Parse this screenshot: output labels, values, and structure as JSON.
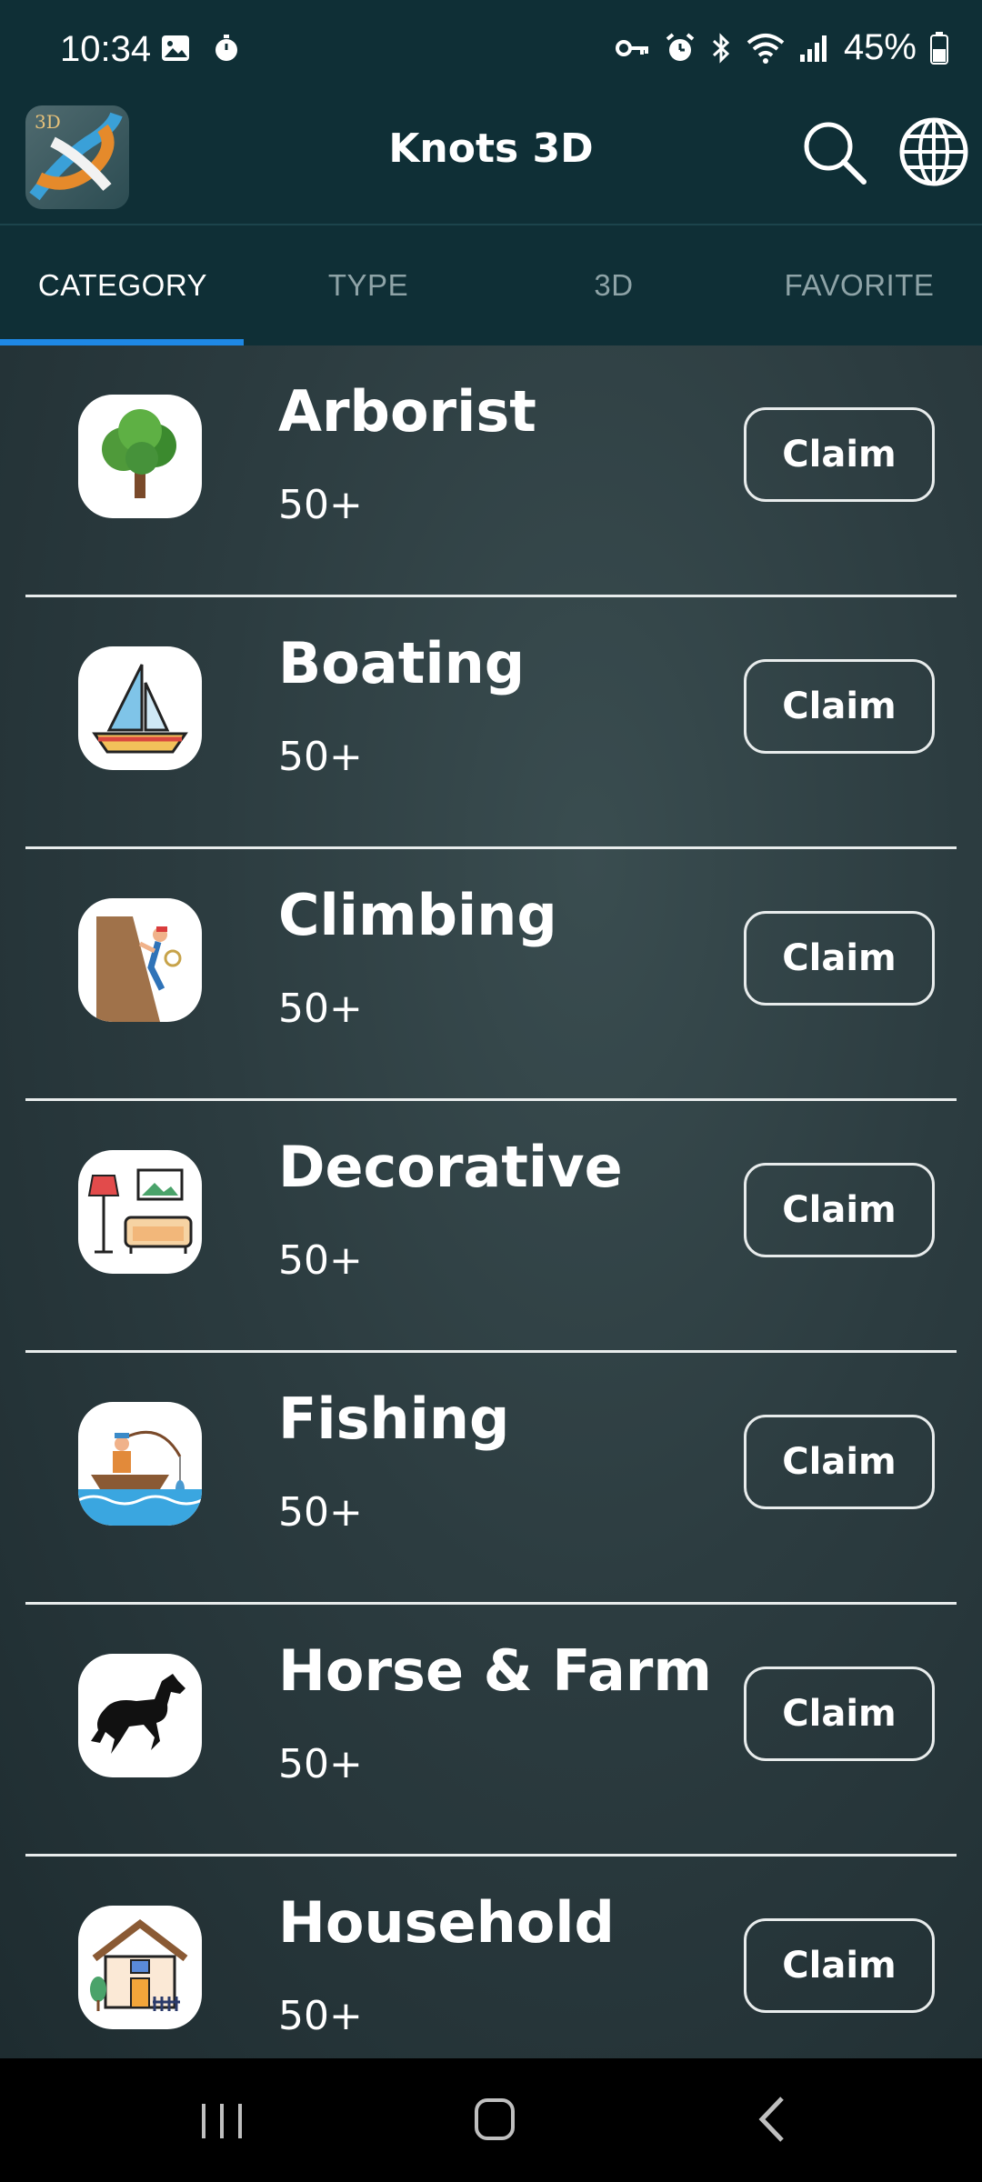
{
  "status_bar": {
    "time": "10:34",
    "battery": "45%",
    "icons_left": [
      "gallery-icon",
      "stopwatch-icon"
    ],
    "icons_right": [
      "key-icon",
      "alarm-icon",
      "bluetooth-icon",
      "wifi-icon",
      "signal-icon",
      "battery-icon"
    ]
  },
  "app_bar": {
    "logo_tag": "3D",
    "title": "Knots 3D",
    "actions": [
      "search-icon",
      "globe-icon"
    ]
  },
  "tabs": [
    {
      "label": "CATEGORY",
      "active": true
    },
    {
      "label": "TYPE",
      "active": false
    },
    {
      "label": "3D",
      "active": false
    },
    {
      "label": "FAVORITE",
      "active": false
    }
  ],
  "categories": [
    {
      "name": "Arborist",
      "count": "50+",
      "button": "Claim",
      "icon": "tree-icon"
    },
    {
      "name": "Boating",
      "count": "50+",
      "button": "Claim",
      "icon": "sailboat-icon"
    },
    {
      "name": "Climbing",
      "count": "50+",
      "button": "Claim",
      "icon": "climber-icon"
    },
    {
      "name": "Decorative",
      "count": "50+",
      "button": "Claim",
      "icon": "living-room-icon"
    },
    {
      "name": "Fishing",
      "count": "50+",
      "button": "Claim",
      "icon": "fisherman-icon"
    },
    {
      "name": "Horse & Farm",
      "count": "50+",
      "button": "Claim",
      "icon": "horse-icon"
    },
    {
      "name": "Household",
      "count": "50+",
      "button": "Claim",
      "icon": "house-icon"
    }
  ],
  "colors": {
    "header_bg": "#0f2f36",
    "tab_indicator": "#1e88e5",
    "divider": "#e8ecec"
  },
  "nav_bar": [
    "recents-icon",
    "home-icon",
    "back-icon"
  ]
}
